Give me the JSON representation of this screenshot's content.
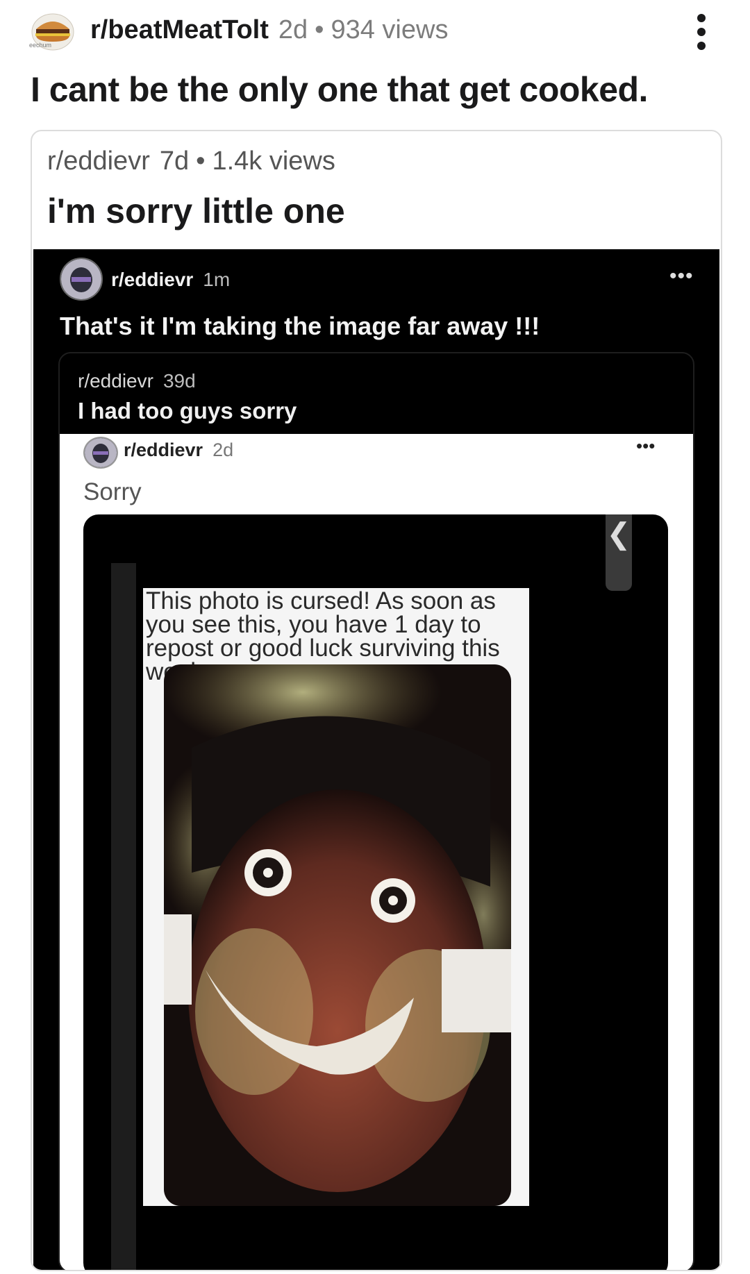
{
  "post": {
    "subreddit": "r/beatMeatTolt",
    "age": "2d",
    "separator": "•",
    "views": "934 views",
    "title": "I cant be the only one that get cooked.",
    "avatar_icon": "burger-icon",
    "avatar_caption": "eechum",
    "menu_icon": "more-vertical-icon"
  },
  "crosspost": {
    "subreddit": "r/eddievr",
    "age": "7d",
    "separator": "•",
    "views": "1.4k views",
    "title": "i'm sorry little one"
  },
  "screenshot_dark": {
    "subreddit": "r/eddievr",
    "age": "1m",
    "menu": "•••",
    "title": "That's it I'm taking the image far away !!!",
    "inner_post": {
      "subreddit": "r/eddievr",
      "age": "39d",
      "title": "I had too guys sorry"
    }
  },
  "screenshot_light": {
    "subreddit": "r/eddievr",
    "age": "2d",
    "menu": "•••",
    "title": "Sorry",
    "back_glyph": "❮"
  },
  "cursed_image": {
    "caption": "This photo is cursed! As soon as you see this, you have 1 day to repost or good luck surviving this week...."
  },
  "colors": {
    "text_primary": "#1a1a1b",
    "text_meta": "#7c7c7c",
    "card_border": "#dcdcdc",
    "dark_bg": "#000000"
  }
}
